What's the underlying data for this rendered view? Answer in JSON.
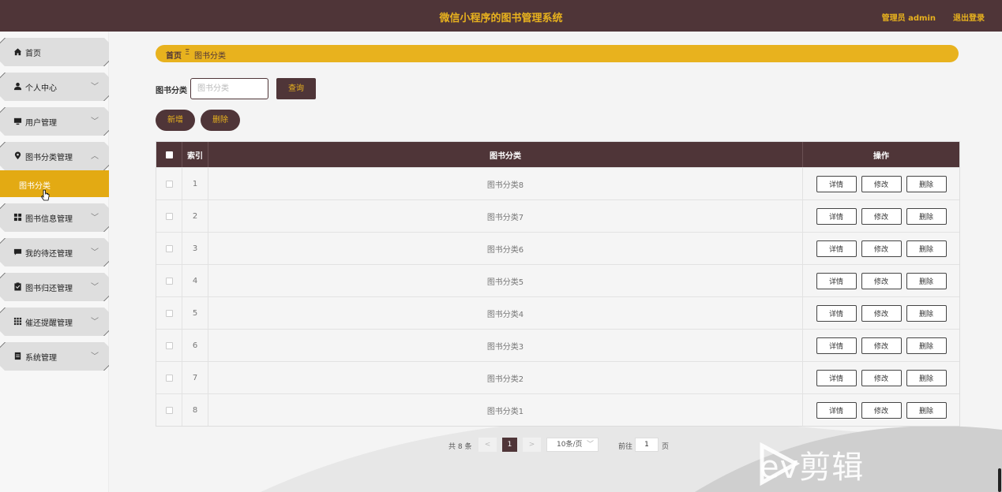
{
  "header": {
    "title": "微信小程序的图书管理系统",
    "user": "管理员 admin",
    "logout": "退出登录"
  },
  "sidebar": {
    "items": [
      {
        "label": "首页",
        "icon": "home-icon",
        "chevron": ""
      },
      {
        "label": "个人中心",
        "icon": "user-icon",
        "chevron": "﹀"
      },
      {
        "label": "用户管理",
        "icon": "monitor-icon",
        "chevron": "﹀"
      },
      {
        "label": "图书分类管理",
        "icon": "location-pin-icon",
        "chevron": "︿"
      },
      {
        "label": "图书信息管理",
        "icon": "grid-icon",
        "chevron": "﹀"
      },
      {
        "label": "我的待还管理",
        "icon": "message-icon",
        "chevron": "﹀"
      },
      {
        "label": "图书归还管理",
        "icon": "clipboard-icon",
        "chevron": "﹀"
      },
      {
        "label": "催还提醒管理",
        "icon": "apps-icon",
        "chevron": "﹀"
      },
      {
        "label": "系统管理",
        "icon": "document-icon",
        "chevron": "﹀"
      }
    ],
    "active_sub": "图书分类"
  },
  "breadcrumb": {
    "home": "首页",
    "separator": "Ξ",
    "current": "图书分类"
  },
  "search": {
    "label": "图书分类",
    "placeholder": "图书分类",
    "query_button": "查询"
  },
  "actions": {
    "add": "新增",
    "delete": "删除"
  },
  "table": {
    "headers": {
      "index": "索引",
      "name": "图书分类",
      "ops": "操作"
    },
    "rows": [
      {
        "index": "1",
        "name": "图书分类8"
      },
      {
        "index": "2",
        "name": "图书分类7"
      },
      {
        "index": "3",
        "name": "图书分类6"
      },
      {
        "index": "4",
        "name": "图书分类5"
      },
      {
        "index": "5",
        "name": "图书分类4"
      },
      {
        "index": "6",
        "name": "图书分类3"
      },
      {
        "index": "7",
        "name": "图书分类2"
      },
      {
        "index": "8",
        "name": "图书分类1"
      }
    ],
    "op_labels": {
      "detail": "详情",
      "edit": "修改",
      "delete": "删除"
    }
  },
  "pagination": {
    "total": "共 8 条",
    "prev": "<",
    "current_page": "1",
    "next": ">",
    "page_size": "10条/页",
    "goto_label": "前往",
    "goto_value": "1",
    "page_suffix": "页"
  },
  "watermark": "ev剪辑",
  "colors": {
    "brand_dark": "#4f3538",
    "accent": "#e8b21e",
    "active_menu": "#e3aa13"
  }
}
